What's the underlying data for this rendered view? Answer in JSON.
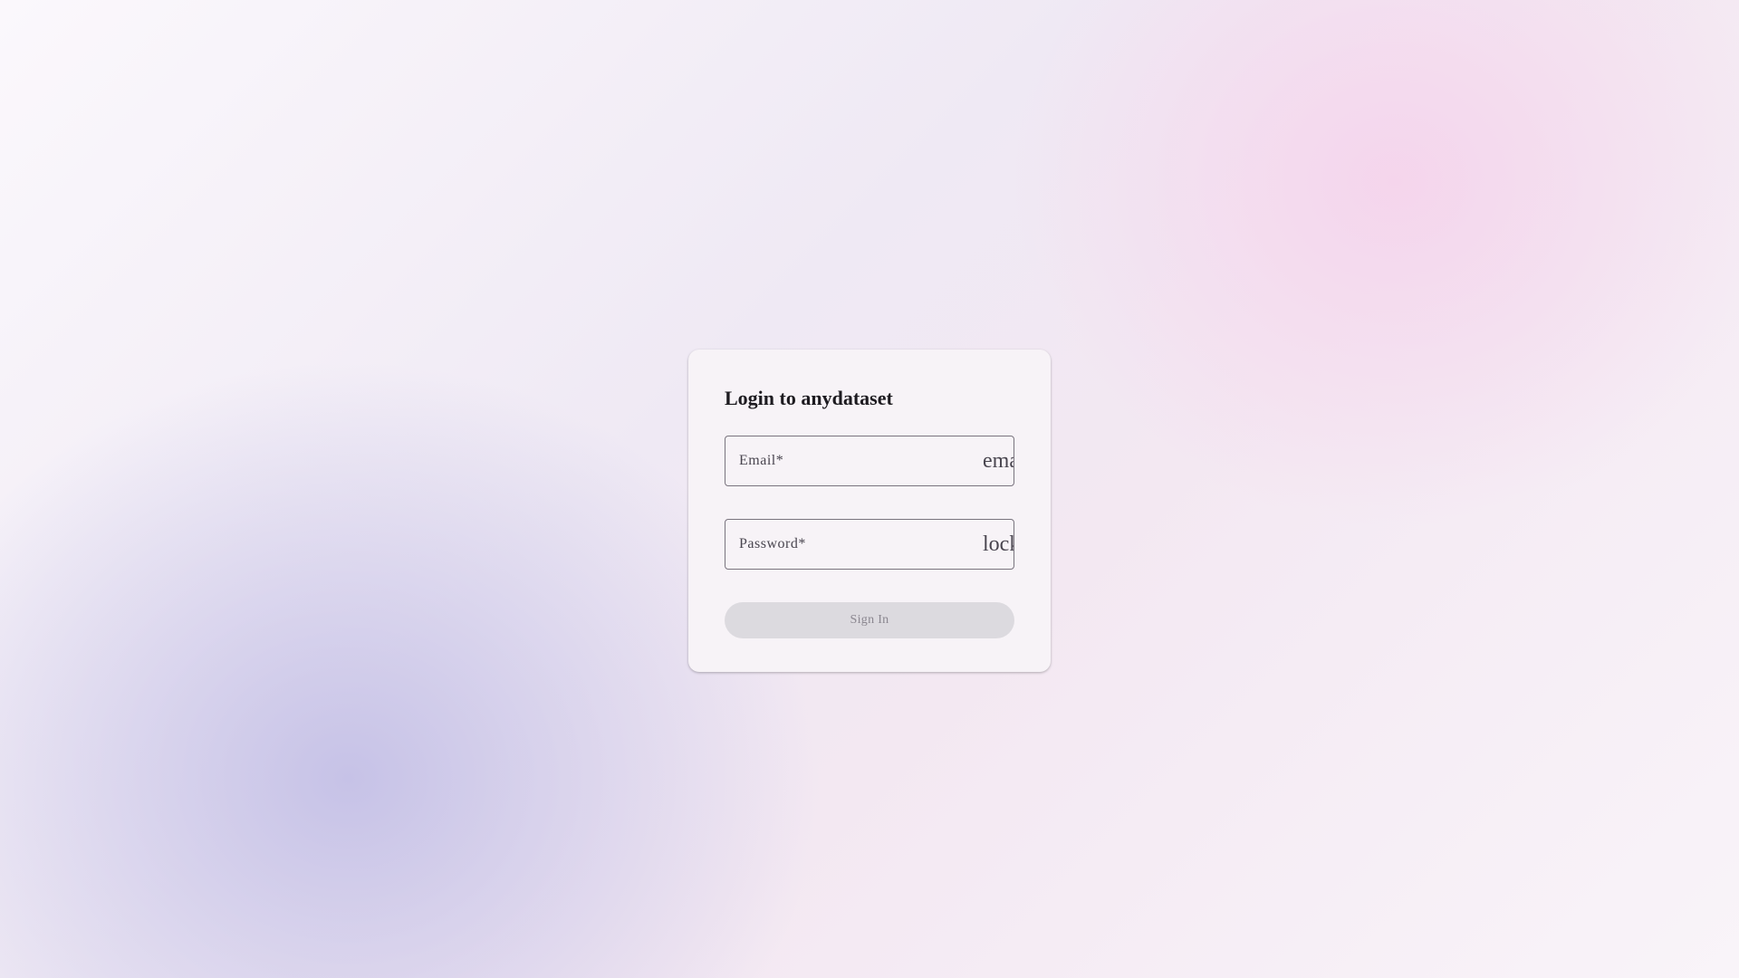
{
  "login": {
    "title": "Login to anydataset",
    "email": {
      "label": "Email*",
      "value": "",
      "trailing_icon": "email",
      "icon_name": "email-icon"
    },
    "password": {
      "label": "Password*",
      "value": "",
      "trailing_icon": "lock",
      "icon_name": "lock-icon"
    },
    "submit_label": "Sign In"
  },
  "colors": {
    "card_background": "#f7f3f7",
    "outline": "#79747e",
    "disabled_button": "#dcdadf",
    "disabled_text": "#8a868f"
  }
}
